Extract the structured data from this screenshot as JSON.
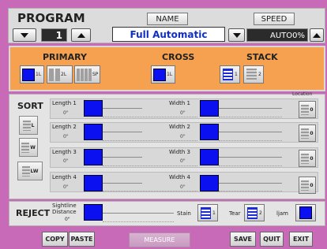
{
  "program": {
    "title": "PROGRAM",
    "number": "1",
    "name_label": "NAME",
    "name_value": "Full Automatic",
    "speed_label": "SPEED",
    "speed_value": "AUTO0%"
  },
  "modes": {
    "primary": {
      "title": "PRIMARY",
      "buttons": [
        {
          "label": "1L",
          "selected": true
        },
        {
          "label": "2L",
          "selected": false
        },
        {
          "label": "SP",
          "selected": false
        }
      ]
    },
    "cross": {
      "title": "CROSS",
      "buttons": [
        {
          "label": "1L",
          "selected": true
        }
      ]
    },
    "stack": {
      "title": "STACK",
      "buttons": [
        {
          "label": "1",
          "selected": true
        },
        {
          "label": "2",
          "selected": false
        }
      ]
    }
  },
  "sort": {
    "title": "SORT",
    "location_label": "Location",
    "buttons": [
      "L",
      "W",
      "LW"
    ],
    "rows": [
      {
        "length_label": "Length 1",
        "length_value": "0\"",
        "width_label": "Width 1",
        "width_value": "0\"",
        "location": "0"
      },
      {
        "length_label": "Length 2",
        "length_value": "0\"",
        "width_label": "Width 2",
        "width_value": "0\"",
        "location": "0"
      },
      {
        "length_label": "Length 3",
        "length_value": "0\"",
        "width_label": "Width 3",
        "width_value": "0\"",
        "location": "0"
      },
      {
        "length_label": "Length 4",
        "length_value": "0\"",
        "width_label": "Width 4",
        "width_value": "0\"",
        "location": "0"
      }
    ]
  },
  "reject": {
    "title": "REJECT",
    "sightline_label": "Sightline",
    "distance_label": "Distance",
    "distance_value": "0\"",
    "stain_label": "Stain",
    "stain_value": "1",
    "tear_label": "Tear",
    "tear_value": "2",
    "ijam_label": "ljam"
  },
  "bottom": {
    "copy": "COPY",
    "paste": "PASTE",
    "measure": "MEASURE",
    "save": "SAVE",
    "quit": "QUIT",
    "exit": "EXIT"
  },
  "colors": {
    "background": "#c86ab8",
    "accent_orange": "#f6a14f",
    "selected_blue": "#0a10f0",
    "name_text": "#1030c0"
  }
}
